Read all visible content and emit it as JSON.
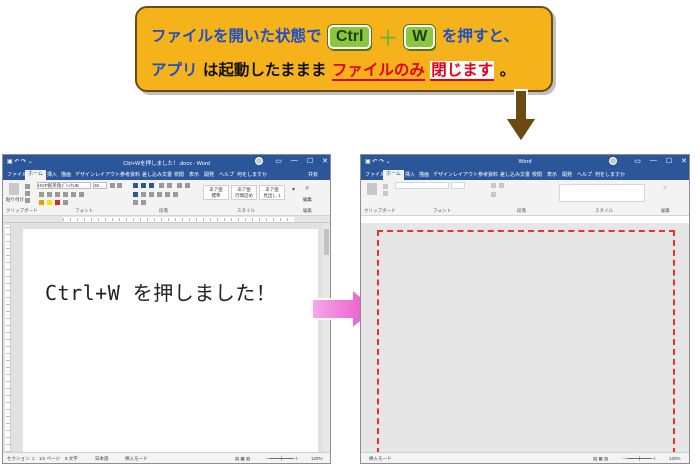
{
  "callout": {
    "line1": {
      "text_a": "ファイルを開いた状態で",
      "key1": "Ctrl",
      "plus": "＋",
      "key2": "W",
      "text_b": "を押すと、"
    },
    "line2": {
      "text_a": "アプリ",
      "text_b": "は起動したままま",
      "text_c": "ファイルのみ",
      "text_d": "閉じます",
      "text_e": "。"
    }
  },
  "left_window": {
    "title": "Ctrl+Wを押しました！.docx  -  Word",
    "tabs": [
      "ファイル",
      "ホーム",
      "挿入",
      "描画",
      "デザイン",
      "レイアウト",
      "参考資料",
      "差し込み文書",
      "校閲",
      "表示",
      "開発",
      "ヘルプ",
      "何をしますか",
      "共有"
    ],
    "font_name": "HGP創英角ｺﾞｼｯｸUB",
    "font_size": "36",
    "group_labels": [
      "クリップボード",
      "フォント",
      "段落",
      "スタイル",
      "編集"
    ],
    "paste_label": "貼り付け",
    "styles": [
      "あア亜",
      "あア亜",
      "あア亜"
    ],
    "style_names": [
      "標準",
      "行間詰め",
      "見出し 1"
    ],
    "editing_label": "編集",
    "page_message": "Ctrl+W を押しました！",
    "status": {
      "section": "セクション: 1",
      "page": "1/1 ページ",
      "words": "9 文字",
      "language": "日本語",
      "mode": "挿入モード",
      "zoom": "120%"
    }
  },
  "right_window": {
    "title": "Word",
    "tabs": [
      "ファイル",
      "ホーム",
      "挿入",
      "描画",
      "デザイン",
      "レイアウト",
      "参考資料",
      "差し込み文書",
      "校閲",
      "表示",
      "開発",
      "ヘルプ",
      "何をしますか"
    ],
    "group_labels": [
      "クリップボード",
      "フォント",
      "段落",
      "スタイル",
      "編集"
    ],
    "status": {
      "mode": "挿入モード",
      "zoom": "120%"
    }
  },
  "colors": {
    "word_blue": "#2b579a",
    "callout_bg": "#f5b21a",
    "key_green": "#8cc63f",
    "dashed_red": "#e8322d",
    "arrow_pink": "#f06ad6"
  }
}
